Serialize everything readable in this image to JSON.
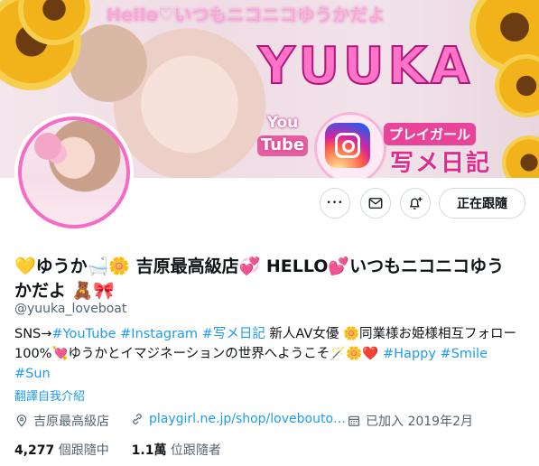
{
  "banner": {
    "greeting": "Hello♡いつもニコニコゆうかだよ",
    "name_logo": "YUUKA",
    "youtube_top": "You",
    "youtube_bottom": "Tube",
    "playgirl": "プレイガール",
    "diary": "写メ日記"
  },
  "actions": {
    "more": "•••",
    "follow_state": "正在跟隨"
  },
  "profile": {
    "display_name": "💛ゆうか🛁🌼 吉原最高級店💞 HELLO💕いつもニコニコゆうかだよ 🧸🎀",
    "handle": "@yuuka_loveboat",
    "bio": {
      "prefix": "SNS→",
      "tag_youtube": "#YouTube",
      "tag_instagram": "#Instagram",
      "tag_diary": "#写メ日記",
      "middle": " 新人AV女優 🌼同業様お姫様相互フォロー100%💘ゆうかとイマジネーションの世界へようこそ🪄🌼❤️ ",
      "tag_happy": "#Happy",
      "tag_smile": "#Smile",
      "tag_sun": "#Sun"
    },
    "translate_label": "翻譯自我介紹",
    "location": "吉原最高級店",
    "website": "playgirl.ne.jp/shop/lovebouto…",
    "joined": "已加入 2019年2月",
    "following_count": "4,277",
    "following_label": "個跟隨中",
    "followers_count": "1.1萬",
    "followers_label": "位跟隨者"
  },
  "colors": {
    "accent": "#1d9bf0",
    "secondary_text": "#536471",
    "border": "#cfd9de",
    "avatar_ring": "#f56bc6"
  }
}
